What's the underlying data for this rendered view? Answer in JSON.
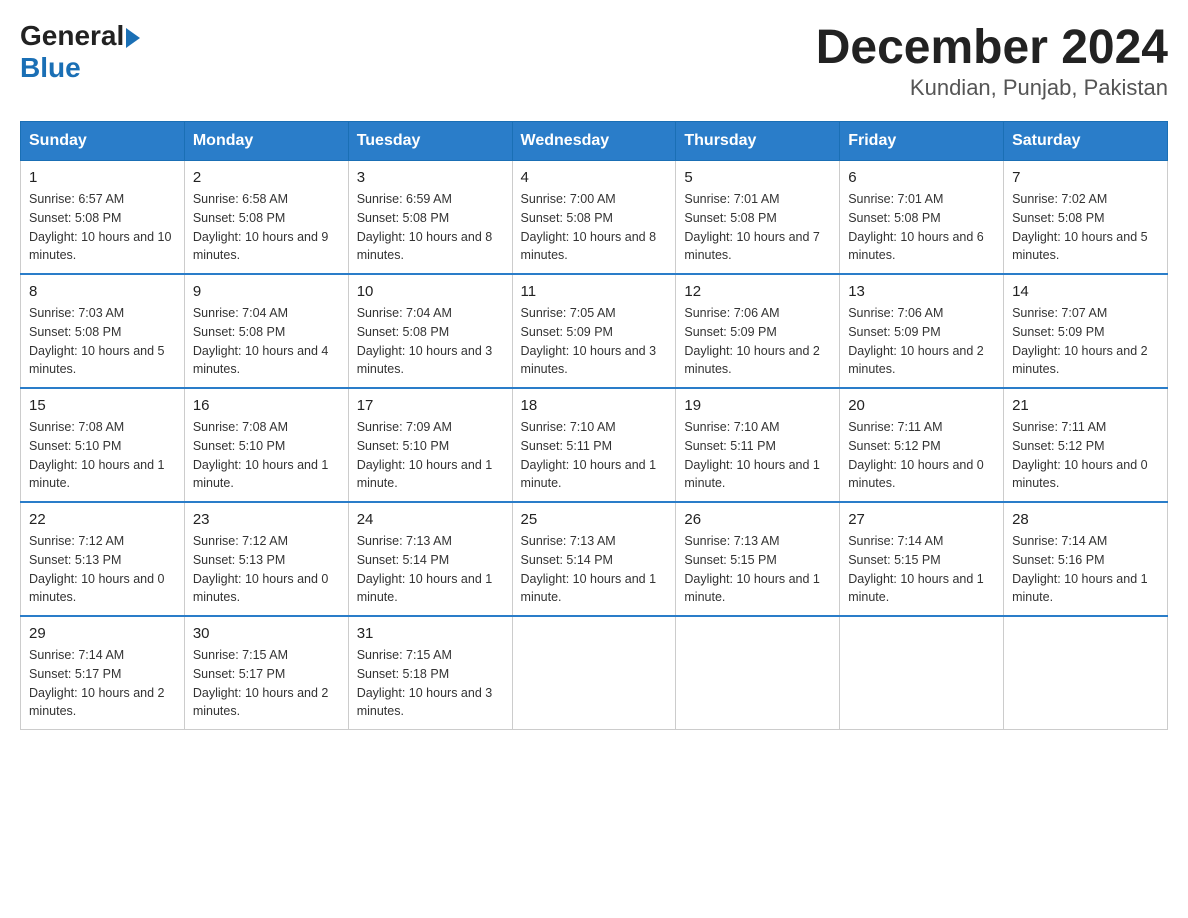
{
  "header": {
    "logo_general": "General",
    "logo_blue": "Blue",
    "title": "December 2024",
    "subtitle": "Kundian, Punjab, Pakistan"
  },
  "days_of_week": [
    "Sunday",
    "Monday",
    "Tuesday",
    "Wednesday",
    "Thursday",
    "Friday",
    "Saturday"
  ],
  "weeks": [
    [
      {
        "day": "1",
        "sunrise": "6:57 AM",
        "sunset": "5:08 PM",
        "daylight": "10 hours and 10 minutes."
      },
      {
        "day": "2",
        "sunrise": "6:58 AM",
        "sunset": "5:08 PM",
        "daylight": "10 hours and 9 minutes."
      },
      {
        "day": "3",
        "sunrise": "6:59 AM",
        "sunset": "5:08 PM",
        "daylight": "10 hours and 8 minutes."
      },
      {
        "day": "4",
        "sunrise": "7:00 AM",
        "sunset": "5:08 PM",
        "daylight": "10 hours and 8 minutes."
      },
      {
        "day": "5",
        "sunrise": "7:01 AM",
        "sunset": "5:08 PM",
        "daylight": "10 hours and 7 minutes."
      },
      {
        "day": "6",
        "sunrise": "7:01 AM",
        "sunset": "5:08 PM",
        "daylight": "10 hours and 6 minutes."
      },
      {
        "day": "7",
        "sunrise": "7:02 AM",
        "sunset": "5:08 PM",
        "daylight": "10 hours and 5 minutes."
      }
    ],
    [
      {
        "day": "8",
        "sunrise": "7:03 AM",
        "sunset": "5:08 PM",
        "daylight": "10 hours and 5 minutes."
      },
      {
        "day": "9",
        "sunrise": "7:04 AM",
        "sunset": "5:08 PM",
        "daylight": "10 hours and 4 minutes."
      },
      {
        "day": "10",
        "sunrise": "7:04 AM",
        "sunset": "5:08 PM",
        "daylight": "10 hours and 3 minutes."
      },
      {
        "day": "11",
        "sunrise": "7:05 AM",
        "sunset": "5:09 PM",
        "daylight": "10 hours and 3 minutes."
      },
      {
        "day": "12",
        "sunrise": "7:06 AM",
        "sunset": "5:09 PM",
        "daylight": "10 hours and 2 minutes."
      },
      {
        "day": "13",
        "sunrise": "7:06 AM",
        "sunset": "5:09 PM",
        "daylight": "10 hours and 2 minutes."
      },
      {
        "day": "14",
        "sunrise": "7:07 AM",
        "sunset": "5:09 PM",
        "daylight": "10 hours and 2 minutes."
      }
    ],
    [
      {
        "day": "15",
        "sunrise": "7:08 AM",
        "sunset": "5:10 PM",
        "daylight": "10 hours and 1 minute."
      },
      {
        "day": "16",
        "sunrise": "7:08 AM",
        "sunset": "5:10 PM",
        "daylight": "10 hours and 1 minute."
      },
      {
        "day": "17",
        "sunrise": "7:09 AM",
        "sunset": "5:10 PM",
        "daylight": "10 hours and 1 minute."
      },
      {
        "day": "18",
        "sunrise": "7:10 AM",
        "sunset": "5:11 PM",
        "daylight": "10 hours and 1 minute."
      },
      {
        "day": "19",
        "sunrise": "7:10 AM",
        "sunset": "5:11 PM",
        "daylight": "10 hours and 1 minute."
      },
      {
        "day": "20",
        "sunrise": "7:11 AM",
        "sunset": "5:12 PM",
        "daylight": "10 hours and 0 minutes."
      },
      {
        "day": "21",
        "sunrise": "7:11 AM",
        "sunset": "5:12 PM",
        "daylight": "10 hours and 0 minutes."
      }
    ],
    [
      {
        "day": "22",
        "sunrise": "7:12 AM",
        "sunset": "5:13 PM",
        "daylight": "10 hours and 0 minutes."
      },
      {
        "day": "23",
        "sunrise": "7:12 AM",
        "sunset": "5:13 PM",
        "daylight": "10 hours and 0 minutes."
      },
      {
        "day": "24",
        "sunrise": "7:13 AM",
        "sunset": "5:14 PM",
        "daylight": "10 hours and 1 minute."
      },
      {
        "day": "25",
        "sunrise": "7:13 AM",
        "sunset": "5:14 PM",
        "daylight": "10 hours and 1 minute."
      },
      {
        "day": "26",
        "sunrise": "7:13 AM",
        "sunset": "5:15 PM",
        "daylight": "10 hours and 1 minute."
      },
      {
        "day": "27",
        "sunrise": "7:14 AM",
        "sunset": "5:15 PM",
        "daylight": "10 hours and 1 minute."
      },
      {
        "day": "28",
        "sunrise": "7:14 AM",
        "sunset": "5:16 PM",
        "daylight": "10 hours and 1 minute."
      }
    ],
    [
      {
        "day": "29",
        "sunrise": "7:14 AM",
        "sunset": "5:17 PM",
        "daylight": "10 hours and 2 minutes."
      },
      {
        "day": "30",
        "sunrise": "7:15 AM",
        "sunset": "5:17 PM",
        "daylight": "10 hours and 2 minutes."
      },
      {
        "day": "31",
        "sunrise": "7:15 AM",
        "sunset": "5:18 PM",
        "daylight": "10 hours and 3 minutes."
      },
      null,
      null,
      null,
      null
    ]
  ],
  "labels": {
    "sunrise": "Sunrise:",
    "sunset": "Sunset:",
    "daylight": "Daylight:"
  }
}
